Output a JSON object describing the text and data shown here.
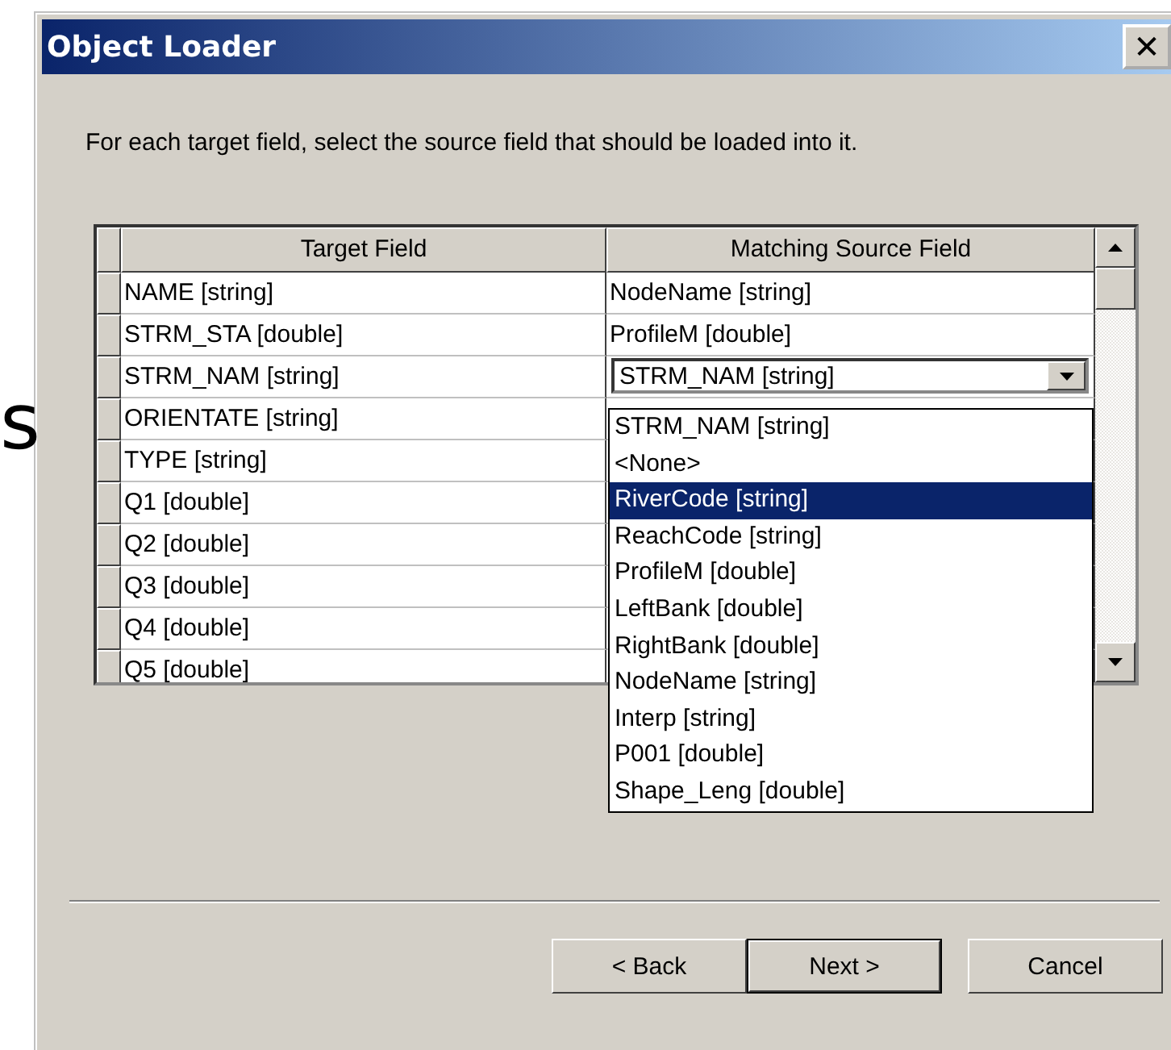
{
  "background_text": "s",
  "window": {
    "title": "Object Loader",
    "close": "✕"
  },
  "instruction": "For each target field, select the source field that should be loaded into it.",
  "table": {
    "columns": [
      "Target Field",
      "Matching Source Field"
    ],
    "rows": [
      {
        "target": "NAME [string]",
        "source": "NodeName [string]",
        "kind": "text"
      },
      {
        "target": "STRM_STA [double]",
        "source": "ProfileM [double]",
        "kind": "text"
      },
      {
        "target": "STRM_NAM [string]",
        "source": "STRM_NAM [string]",
        "kind": "combo"
      },
      {
        "target": "ORIENTATE [string]",
        "kind": "text"
      },
      {
        "target": "TYPE [string]",
        "kind": "text"
      },
      {
        "target": "Q1 [double]",
        "kind": "text"
      },
      {
        "target": "Q2 [double]",
        "kind": "text"
      },
      {
        "target": "Q3 [double]",
        "kind": "text"
      },
      {
        "target": "Q4 [double]",
        "kind": "text"
      },
      {
        "target": "Q5 [double]",
        "kind": "text"
      }
    ]
  },
  "dropdown": {
    "items": [
      {
        "label": "STRM_NAM [string]",
        "selected": false
      },
      {
        "label": "<None>",
        "selected": false
      },
      {
        "label": "RiverCode [string]",
        "selected": true
      },
      {
        "label": "ReachCode [string]",
        "selected": false
      },
      {
        "label": "ProfileM [double]",
        "selected": false
      },
      {
        "label": "LeftBank [double]",
        "selected": false
      },
      {
        "label": "RightBank [double]",
        "selected": false
      },
      {
        "label": "NodeName [string]",
        "selected": false
      },
      {
        "label": "Interp [string]",
        "selected": false
      },
      {
        "label": "P001 [double]",
        "selected": false
      },
      {
        "label": "Shape_Leng [double]",
        "selected": false
      }
    ]
  },
  "buttons": [
    {
      "label": "< Back",
      "default": false
    },
    {
      "label": "Next >",
      "default": true
    },
    {
      "label": "Cancel",
      "default": false
    }
  ]
}
